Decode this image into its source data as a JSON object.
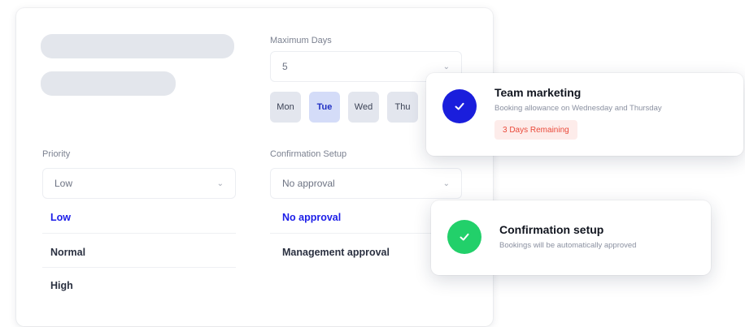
{
  "form": {
    "max_days_label": "Maximum Days",
    "max_days_value": "5",
    "days": [
      {
        "label": "Mon",
        "selected": false
      },
      {
        "label": "Tue",
        "selected": true
      },
      {
        "label": "Wed",
        "selected": false
      },
      {
        "label": "Thu",
        "selected": false
      }
    ],
    "priority_label": "Priority",
    "priority_value": "Low",
    "priority_options": [
      "Low",
      "Normal",
      "High"
    ],
    "confirmation_label": "Confirmation Setup",
    "confirmation_value": "No approval",
    "confirmation_options": [
      "No approval",
      "Management approval"
    ]
  },
  "toast_marketing": {
    "title": "Team marketing",
    "subtitle": "Booking allowance on Wednesday and Thursday",
    "badge": "3 Days Remaining",
    "icon_color": "#1a1edc"
  },
  "toast_confirmation": {
    "title": "Confirmation setup",
    "subtitle": "Bookings will be automatically approved",
    "icon_color": "#22d06a"
  },
  "colors": {
    "accent": "#1c1ee8",
    "success": "#22d06a",
    "warning": "#ea4a3a"
  }
}
